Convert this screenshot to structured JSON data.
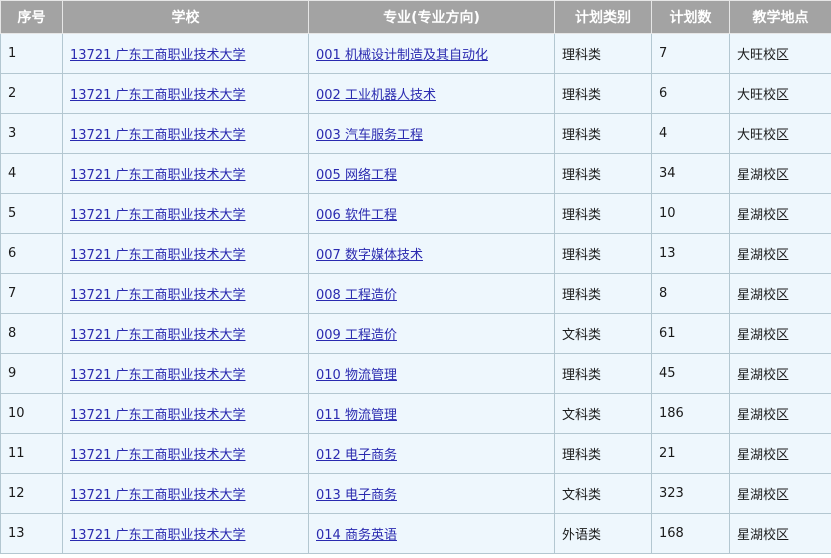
{
  "table": {
    "headers": [
      "序号",
      "学校",
      "专业(专业方向)",
      "计划类别",
      "计划数",
      "教学地点"
    ],
    "rows": [
      {
        "index": "1",
        "school": "13721 广东工商职业技术大学",
        "major": "001 机械设计制造及其自动化",
        "category": "理科类",
        "plan": "7",
        "campus": "大旺校区"
      },
      {
        "index": "2",
        "school": "13721 广东工商职业技术大学",
        "major": "002 工业机器人技术",
        "category": "理科类",
        "plan": "6",
        "campus": "大旺校区"
      },
      {
        "index": "3",
        "school": "13721 广东工商职业技术大学",
        "major": "003 汽车服务工程",
        "category": "理科类",
        "plan": "4",
        "campus": "大旺校区"
      },
      {
        "index": "4",
        "school": "13721 广东工商职业技术大学",
        "major": "005 网络工程",
        "category": "理科类",
        "plan": "34",
        "campus": "星湖校区"
      },
      {
        "index": "5",
        "school": "13721 广东工商职业技术大学",
        "major": "006 软件工程",
        "category": "理科类",
        "plan": "10",
        "campus": "星湖校区"
      },
      {
        "index": "6",
        "school": "13721 广东工商职业技术大学",
        "major": "007 数字媒体技术",
        "category": "理科类",
        "plan": "13",
        "campus": "星湖校区"
      },
      {
        "index": "7",
        "school": "13721 广东工商职业技术大学",
        "major": "008 工程造价",
        "category": "理科类",
        "plan": "8",
        "campus": "星湖校区"
      },
      {
        "index": "8",
        "school": "13721 广东工商职业技术大学",
        "major": "009 工程造价",
        "category": "文科类",
        "plan": "61",
        "campus": "星湖校区"
      },
      {
        "index": "9",
        "school": "13721 广东工商职业技术大学",
        "major": "010 物流管理",
        "category": "理科类",
        "plan": "45",
        "campus": "星湖校区"
      },
      {
        "index": "10",
        "school": "13721 广东工商职业技术大学",
        "major": "011 物流管理",
        "category": "文科类",
        "plan": "186",
        "campus": "星湖校区"
      },
      {
        "index": "11",
        "school": "13721 广东工商职业技术大学",
        "major": "012 电子商务",
        "category": "理科类",
        "plan": "21",
        "campus": "星湖校区"
      },
      {
        "index": "12",
        "school": "13721 广东工商职业技术大学",
        "major": "013 电子商务",
        "category": "文科类",
        "plan": "323",
        "campus": "星湖校区"
      },
      {
        "index": "13",
        "school": "13721 广东工商职业技术大学",
        "major": "014 商务英语",
        "category": "外语类",
        "plan": "168",
        "campus": "星湖校区"
      }
    ]
  }
}
